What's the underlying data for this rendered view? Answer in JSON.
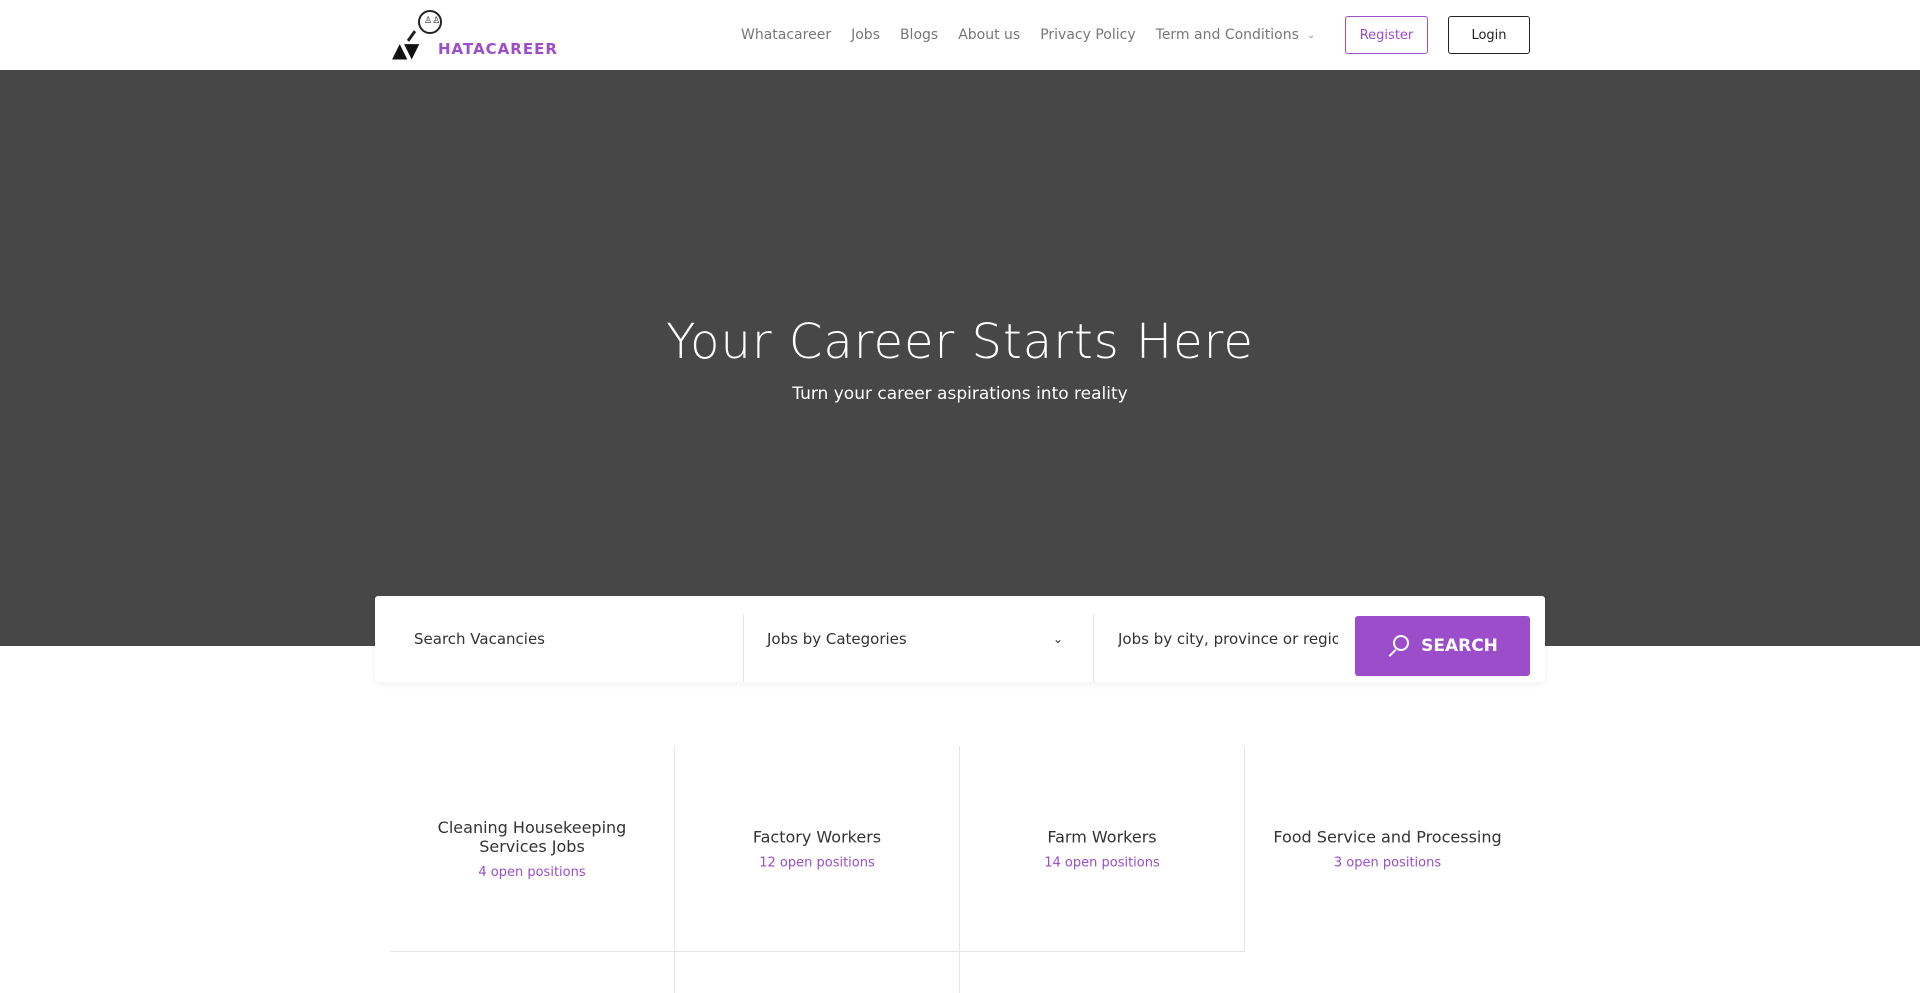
{
  "header": {
    "logo_text": "HATACAREER",
    "nav": [
      "Whatacareer",
      "Jobs",
      "Blogs",
      "About us",
      "Privacy Policy",
      "Term and Conditions"
    ],
    "register_label": "Register",
    "login_label": "Login"
  },
  "hero": {
    "title": "Your Career Starts Here",
    "subtitle": "Turn your career aspirations into reality"
  },
  "search": {
    "keyword_placeholder": "Search Vacancies",
    "category_selected": "Jobs by Categories",
    "location_placeholder": "Jobs by city, province or regio",
    "button_label": "SEARCH"
  },
  "categories": [
    {
      "title": "Cleaning Housekeeping Services Jobs",
      "count": "4 open positions"
    },
    {
      "title": "Factory Workers",
      "count": "12 open positions"
    },
    {
      "title": "Farm Workers",
      "count": "14 open positions"
    },
    {
      "title": "Food Service and Processing",
      "count": "3 open positions"
    }
  ],
  "colors": {
    "accent": "#9b4dca",
    "hero_bg": "#474747"
  }
}
